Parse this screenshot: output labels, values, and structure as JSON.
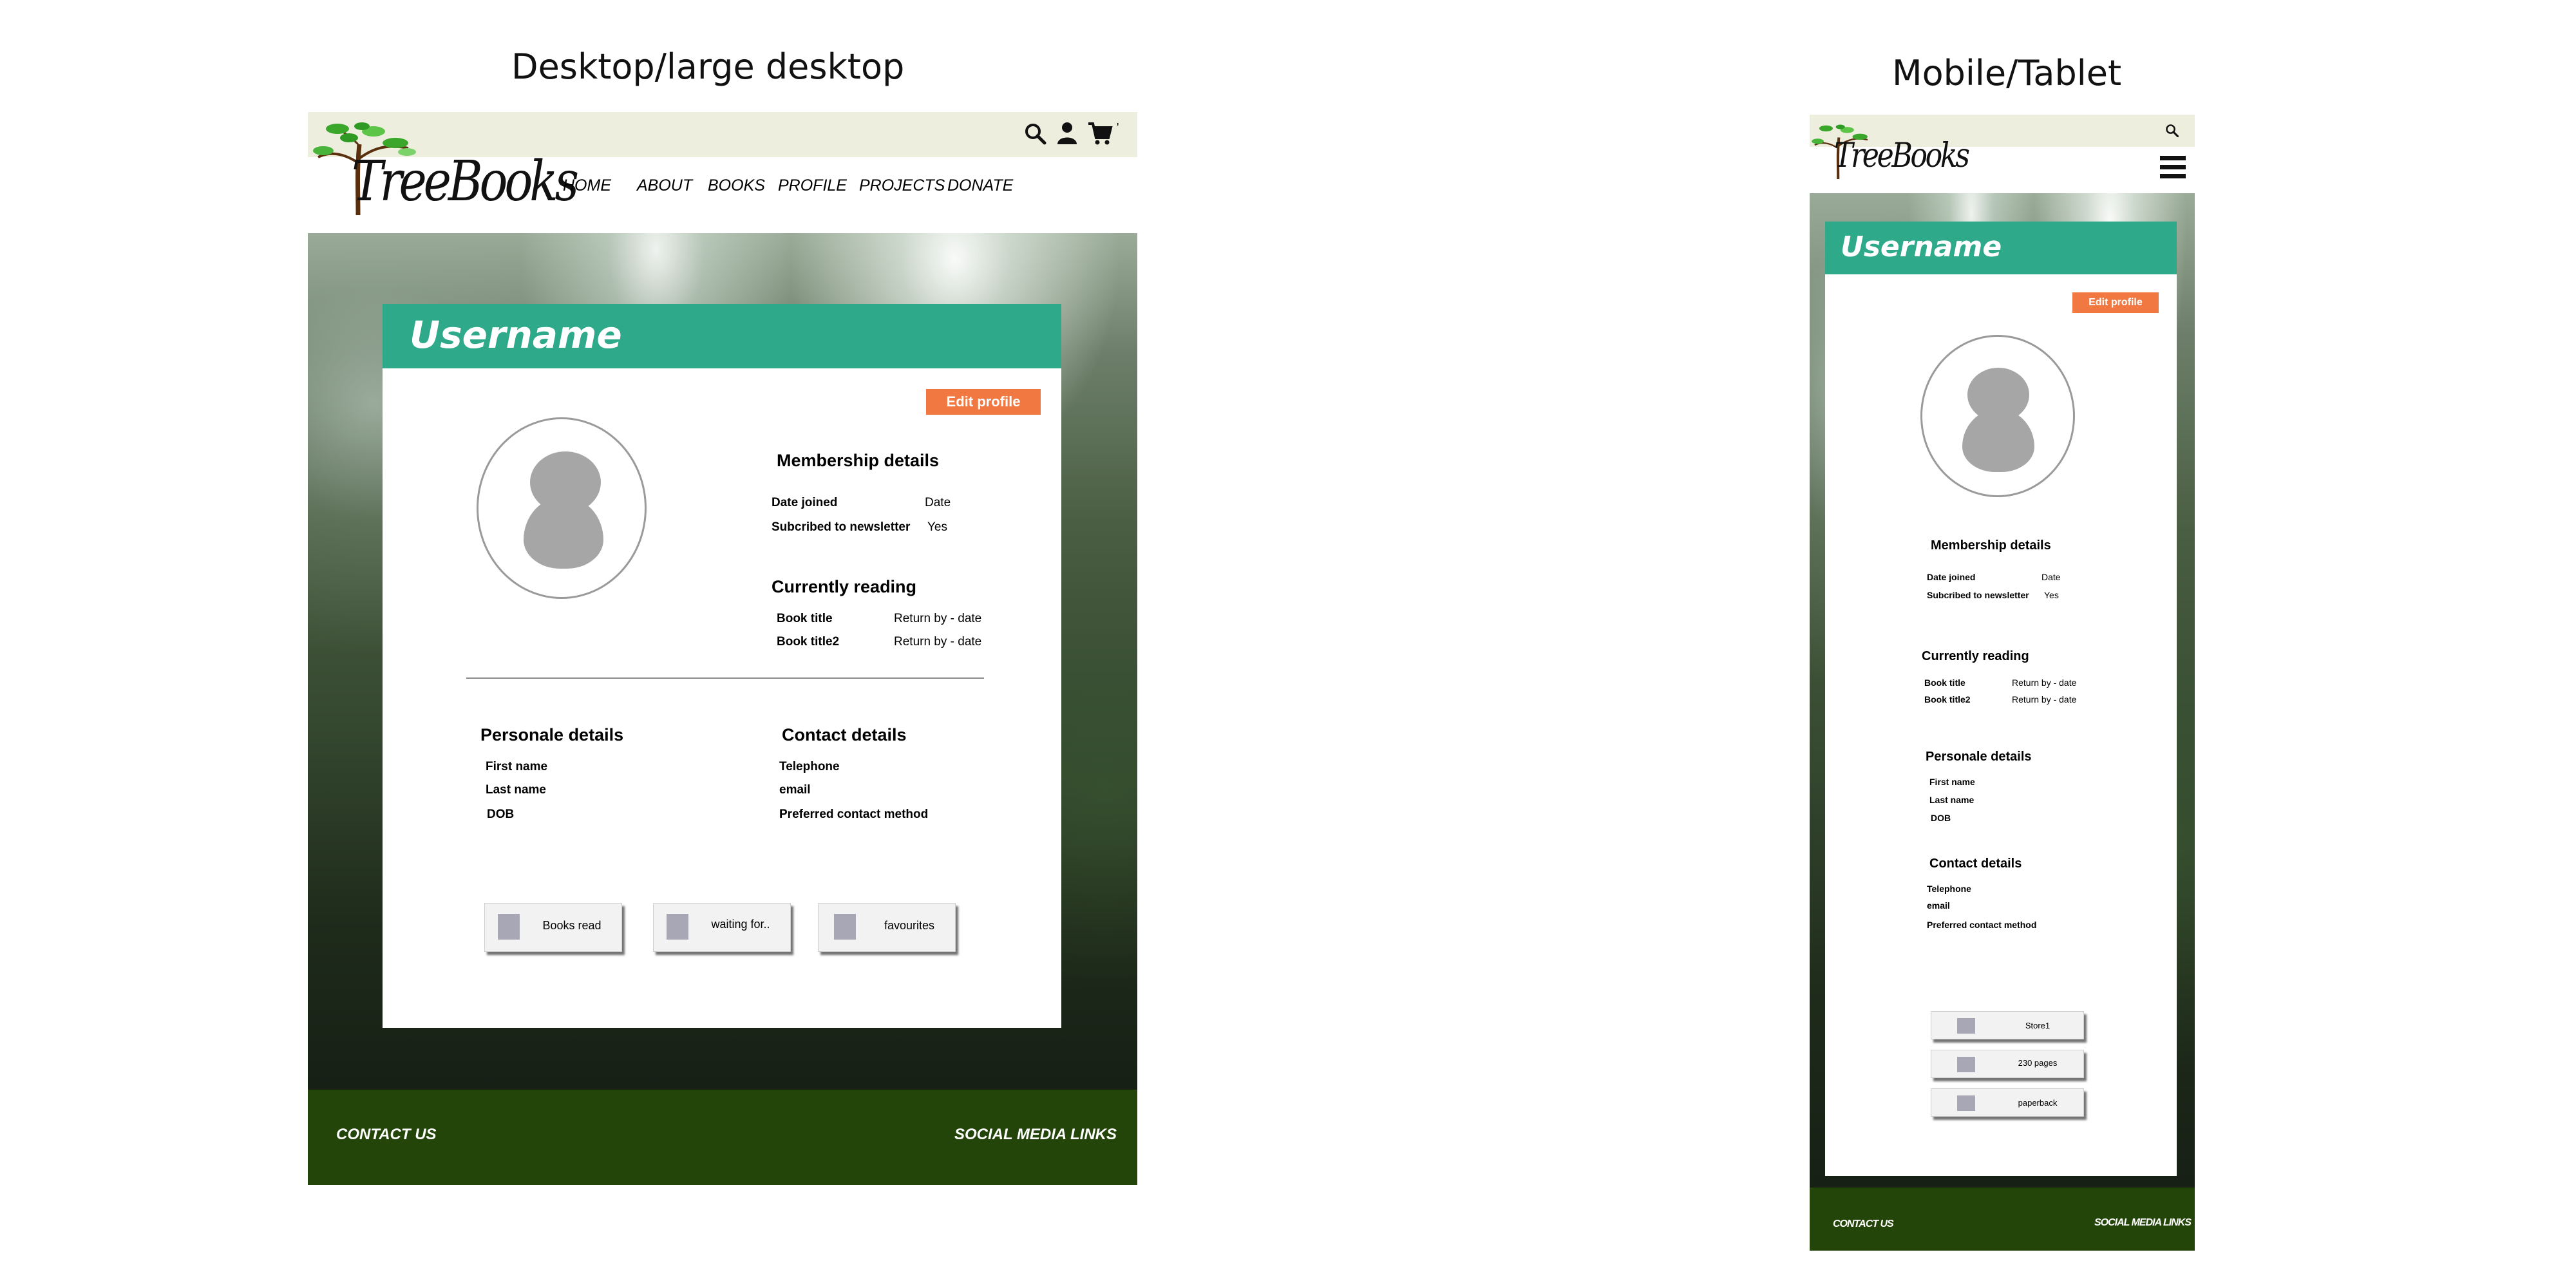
{
  "desktop": {
    "heading": "Desktop/large desktop",
    "brand": "TreeBooks",
    "nav": [
      "HOME",
      "ABOUT",
      "BOOKS",
      "PROFILE",
      "PROJECTS",
      "DONATE"
    ],
    "cart_count": "'",
    "profile": {
      "username": "Username",
      "edit_label": "Edit profile",
      "membership_title": "Membership details",
      "membership": [
        {
          "label": "Date joined",
          "value": "Date"
        },
        {
          "label": "Subcribed to newsletter",
          "value": "Yes"
        }
      ],
      "reading_title": "Currently reading",
      "reading": [
        {
          "label": "Book title",
          "value": "Return by -  date"
        },
        {
          "label": "Book title2",
          "value": "Return by -  date"
        }
      ],
      "personal_title": "Personale details",
      "personal": [
        "First name",
        "Last name",
        "DOB"
      ],
      "contact_title": "Contact details",
      "contact": [
        "Telephone",
        "email",
        "Preferred contact method"
      ],
      "lists": [
        "Books read",
        "waiting for..",
        "favourites"
      ]
    },
    "footer": {
      "contact": "CONTACT US",
      "social": "SOCIAL MEDIA LINKS"
    }
  },
  "mobile": {
    "heading": "Mobile/Tablet",
    "brand": "TreeBooks",
    "profile": {
      "username": "Username",
      "edit_label": "Edit profile",
      "membership_title": "Membership details",
      "membership": [
        {
          "label": "Date joined",
          "value": "Date"
        },
        {
          "label": "Subcribed to newsletter",
          "value": "Yes"
        }
      ],
      "reading_title": "Currently reading",
      "reading": [
        {
          "label": "Book title",
          "value": "Return by -  date"
        },
        {
          "label": "Book title2",
          "value": "Return by -  date"
        }
      ],
      "personal_title": "Personale details",
      "personal": [
        "First name",
        "Last name",
        "DOB"
      ],
      "contact_title": "Contact details",
      "contact": [
        "Telephone",
        "email",
        "Preferred contact method"
      ],
      "lists": [
        "Store1",
        "230 pages",
        "paperback"
      ]
    },
    "footer": {
      "contact": "CONTACT US",
      "social": "SOCIAL MEDIA LINKS"
    }
  },
  "icons": {
    "search": "search-icon",
    "user": "user-icon",
    "cart": "cart-icon",
    "menu": "hamburger-menu-icon",
    "logo": "tree-logo"
  },
  "colors": {
    "topbar": "#eeeedf",
    "header_green": "#2ea98a",
    "edit_orange": "#f27842",
    "footer_green": "#244509"
  }
}
